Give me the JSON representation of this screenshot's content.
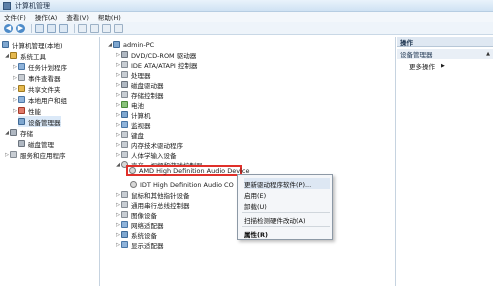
{
  "window": {
    "title": "计算机管理"
  },
  "menu": [
    "文件(F)",
    "操作(A)",
    "查看(V)",
    "帮助(H)"
  ],
  "toolbar": {
    "back": "◀",
    "forward": "▶"
  },
  "left_tree": {
    "root": "计算机管理(本地)",
    "system_tools": "系统工具",
    "items": [
      "任务计划程序",
      "事件查看器",
      "共享文件夹",
      "本地用户和组",
      "性能",
      "设备管理器"
    ],
    "storage": "存储",
    "disk_mgmt": "磁盘管理",
    "services": "服务和应用程序"
  },
  "device_tree": {
    "root": "admin-PC",
    "items": [
      "DVD/CD-ROM 驱动器",
      "IDE ATA/ATAPI 控制器",
      "处理器",
      "磁盘驱动器",
      "存储控制器",
      "电池",
      "计算机",
      "监视器",
      "键盘",
      "内存技术驱动程序",
      "人体学输入设备",
      "声音、视频和游戏控制器"
    ],
    "highlighted": "AMD High Definition Audio Device",
    "second_audio": "IDT High Definition Audio CO",
    "after": [
      "鼠标和其他指针设备",
      "通用串行总线控制器",
      "图像设备",
      "网络适配器",
      "系统设备",
      "显示适配器"
    ]
  },
  "context_menu": {
    "update": "更新驱动程序软件(P)...",
    "enable": "启用(E)",
    "uninstall": "卸载(U)",
    "scan": "扫描检测硬件改动(A)",
    "properties": "属性(R)"
  },
  "actions": {
    "header": "操作",
    "section": "设备管理器",
    "more": "更多操作"
  }
}
